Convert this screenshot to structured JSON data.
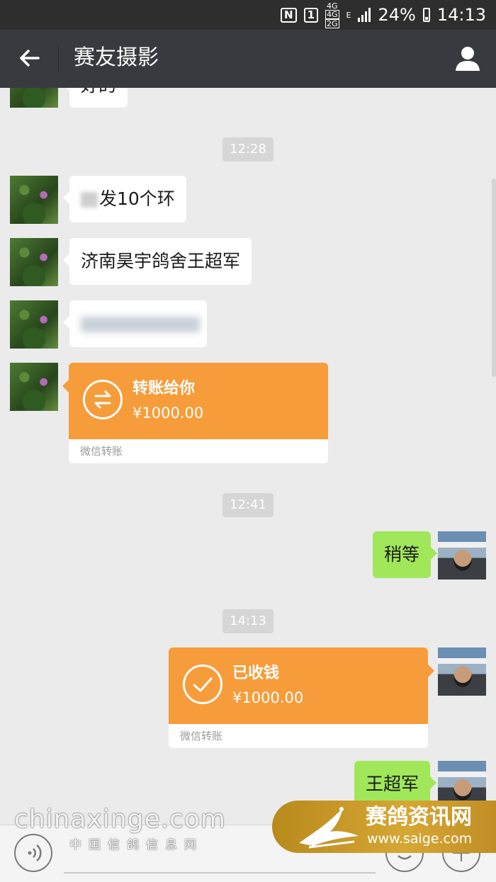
{
  "status_bar": {
    "nfc": "N",
    "sim": "1",
    "net_top": "4G",
    "net_mid": "4G",
    "net_bot": "2G",
    "edge": "E",
    "battery": "24%",
    "time": "14:13"
  },
  "header": {
    "title": "赛友摄影"
  },
  "messages": {
    "partial_top": "好的",
    "time_1": "12:28",
    "msg_1_suffix": "发10个环",
    "msg_2": "济南昊宇鸽舍王超军",
    "transfer_1": {
      "title": "转账给你",
      "amount": "¥1000.00",
      "footer": "微信转账"
    },
    "time_2": "12:41",
    "reply_1": "稍等",
    "time_3": "14:13",
    "transfer_2": {
      "title": "已收钱",
      "amount": "¥1000.00",
      "footer": "微信转账"
    },
    "reply_2": "王超军"
  },
  "watermark": {
    "left_big": "chinaxinge.com",
    "left_small": "中国信鸽信息网",
    "right_cn": "赛鸽资讯网",
    "right_url": "www.saige.com"
  },
  "colors": {
    "title_bar": "#393a3f",
    "status_bar": "#2e2e2e",
    "chat_bg": "#ebebeb",
    "transfer_orange": "#f79c3a",
    "sent_green": "#a0e75a"
  },
  "icons": {
    "back": "arrow-left-icon",
    "profile": "person-icon",
    "transfer": "exchange-arrows-icon",
    "received": "checkmark-icon",
    "voice": "voice-icon",
    "emoji": "emoji-icon",
    "plus": "plus-icon"
  }
}
